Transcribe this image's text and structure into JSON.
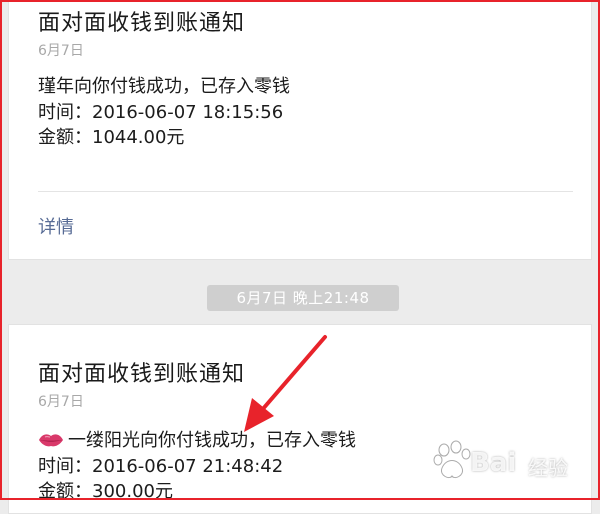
{
  "notifications": [
    {
      "title": "面对面收钱到账通知",
      "date": "6月7日",
      "message": "瑾年向你付钱成功，已存入零钱",
      "time_line": "时间：2016-06-07 18:15:56",
      "amount_line": "金额：1044.00元",
      "details_label": "详情"
    },
    {
      "title": "面对面收钱到账通知",
      "date": "6月7日",
      "message": "一缕阳光向你付钱成功，已存入零钱",
      "time_line": "时间：2016-06-07 21:48:42",
      "amount_line": "金额：300.00元"
    }
  ],
  "separator_timestamp": "6月7日 晚上21:48",
  "watermark": {
    "brand": "Bai",
    "brand_suffix": "经验"
  },
  "colors": {
    "frame": "#e8232b",
    "arrow": "#e8232b",
    "link": "#576b95",
    "background": "#ececec"
  },
  "icons": {
    "emoji": "lips-icon"
  }
}
